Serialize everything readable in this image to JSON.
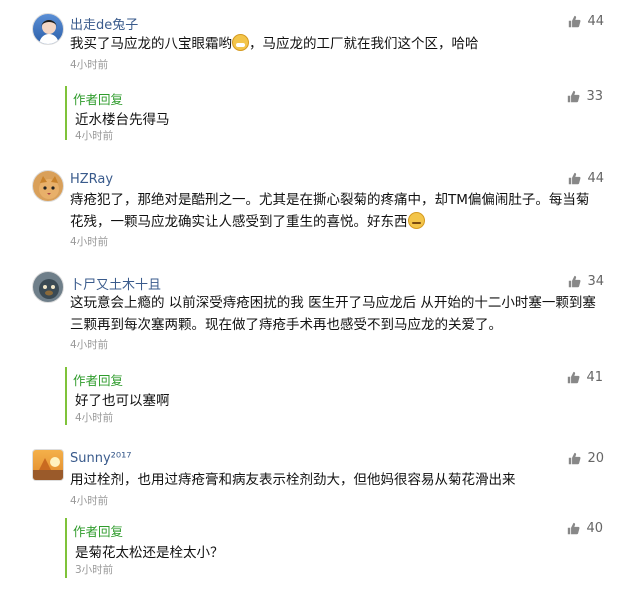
{
  "comments": [
    {
      "user": "出走de兔子",
      "text": "我买了马应龙的八宝眼霜哟",
      "text2": "，马应龙的工厂就在我们这个区，哈哈",
      "time": "4小时前",
      "likes": "44",
      "avatar_color": "#3b6fb8",
      "reply": {
        "author": "作者回复",
        "text": "近水楼台先得马",
        "time": "4小时前",
        "likes": "33"
      }
    },
    {
      "user": "HZRay",
      "text_lines": [
        "痔疮犯了，那绝对是酷刑之一。尤其是在撕心裂菊的疼痛中，却TM偏偏闹肚子。每当菊",
        "花残，一颗马应龙确实让人感受到了重生的喜悦。好东西"
      ],
      "time": "4小时前",
      "likes": "44",
      "avatar_color": "#c9822b"
    },
    {
      "user": "卜尸又土木十且",
      "text_lines": [
        "这玩意会上瘾的 以前深受痔疮困扰的我 医生开了马应龙后 从开始的十二小时塞一颗到塞",
        "三颗再到每次塞两颗。现在做了痔疮手术再也感受不到马应龙的关爱了。"
      ],
      "time": "4小时前",
      "likes": "34",
      "avatar_color": "#4a5a66",
      "reply": {
        "author": "作者回复",
        "text": "好了也可以塞啊",
        "time": "4小时前",
        "likes": "41"
      }
    },
    {
      "user": "Sunny²⁰¹⁷",
      "text": "用过栓剂，也用过痔疮膏和病友表示栓剂劲大，但他妈很容易从菊花滑出来",
      "time": "4小时前",
      "likes": "20",
      "avatar_color": "#e0892a",
      "reply": {
        "author": "作者回复",
        "text": "是菊花太松还是栓太小？",
        "time": "3小时前",
        "likes": "40"
      }
    }
  ],
  "icons": {
    "like": "thumbs-up-icon",
    "emoji": "grin-emoji-icon"
  },
  "colors": {
    "username": "#3a5b8c",
    "reply_author": "#2f9c2c",
    "reply_bar": "#7fc33a",
    "time": "#999999"
  }
}
